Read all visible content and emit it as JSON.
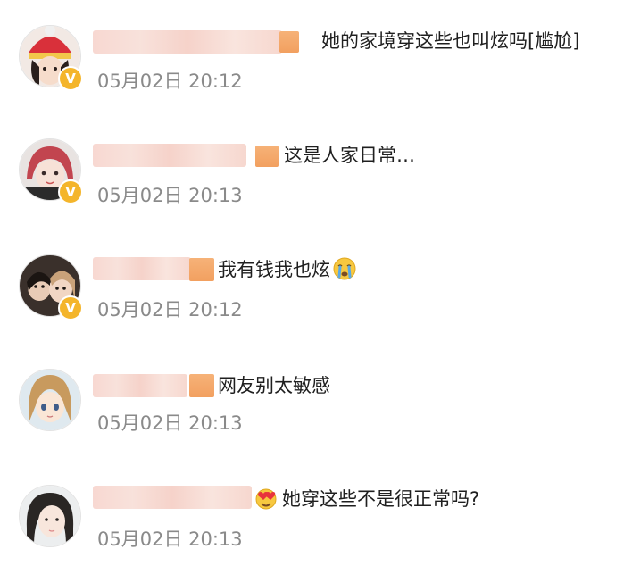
{
  "comments": [
    {
      "text": "她的家境穿这些也叫炫吗[尴尬]",
      "date": "05月02日",
      "time": "20:12",
      "verified_mark": "V"
    },
    {
      "text": "这是人家日常…",
      "date": "05月02日",
      "time": "20:13",
      "verified_mark": "V"
    },
    {
      "text": "我有钱我也炫",
      "emoji": "crying-face-icon",
      "date": "05月02日",
      "time": "20:12",
      "verified_mark": "V"
    },
    {
      "text": "网友别太敏感",
      "date": "05月02日",
      "time": "20:13"
    },
    {
      "text": "她穿这些不是很正常吗?",
      "emoji": "heart-eyes-icon",
      "date": "05月02日",
      "time": "20:13"
    }
  ],
  "colors": {
    "verified_badge": "#f4b52b",
    "timestamp": "#8a8a8a",
    "name_blur": "#f7d6cf",
    "name_tag": "#f2a060"
  }
}
